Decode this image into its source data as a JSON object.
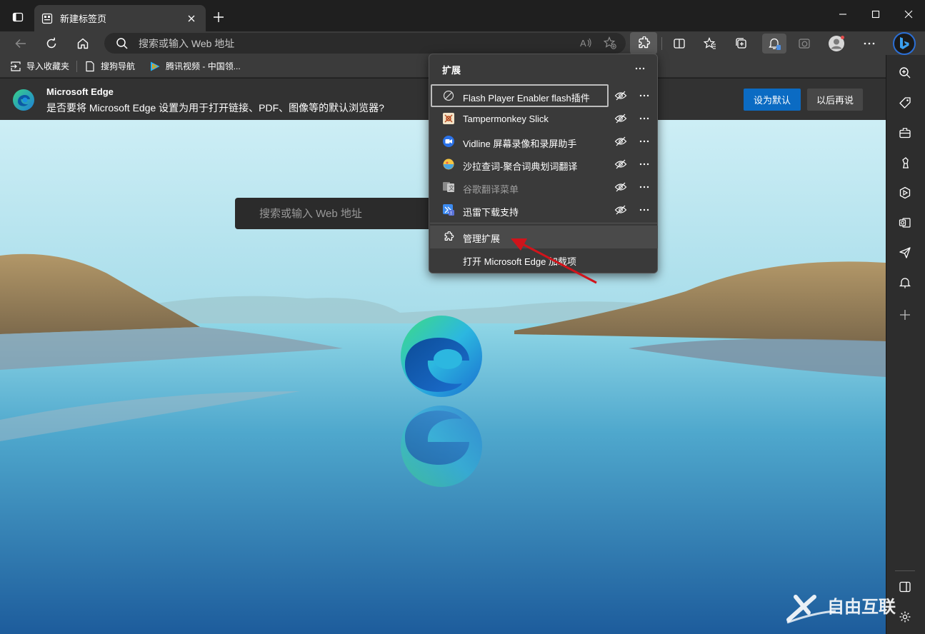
{
  "tab": {
    "title": "新建标签页"
  },
  "address": {
    "placeholder": "搜索或输入 Web 地址"
  },
  "favorites": [
    {
      "label": "导入收藏夹",
      "icon": "import-icon"
    },
    {
      "label": "搜狗导航",
      "icon": "page-icon"
    },
    {
      "label": "腾讯视频 - 中国领...",
      "icon": "tencent-video-icon"
    }
  ],
  "banner": {
    "title": "Microsoft Edge",
    "message": "是否要将 Microsoft Edge 设置为用于打开链接、PDF、图像等的默认浏览器?",
    "primary_label": "设为默认",
    "secondary_label": "以后再说"
  },
  "page": {
    "search_placeholder": "搜索或输入 Web 地址"
  },
  "extensions_menu": {
    "header": "扩展",
    "items": [
      {
        "name": "Flash Player Enabler flash插件",
        "icon": "flash-icon",
        "enabled": true
      },
      {
        "name": "Tampermonkey Slick",
        "icon": "tampermonkey-icon",
        "enabled": true
      },
      {
        "name": "Vidline 屏幕录像和录屏助手",
        "icon": "vidline-icon",
        "enabled": true
      },
      {
        "name": "沙拉查词-聚合词典划词翻译",
        "icon": "saladict-icon",
        "enabled": true
      },
      {
        "name": "谷歌翻译菜单",
        "icon": "google-translate-icon",
        "enabled": false
      },
      {
        "name": "迅雷下载支持",
        "icon": "thunder-icon",
        "enabled": true
      }
    ],
    "manage_label": "管理扩展",
    "addons_label": "打开 Microsoft Edge 加载项"
  },
  "colors": {
    "accent": "#0b6bc3",
    "annotation_arrow": "#d0141b"
  },
  "watermark": {
    "text": "自由互联"
  }
}
